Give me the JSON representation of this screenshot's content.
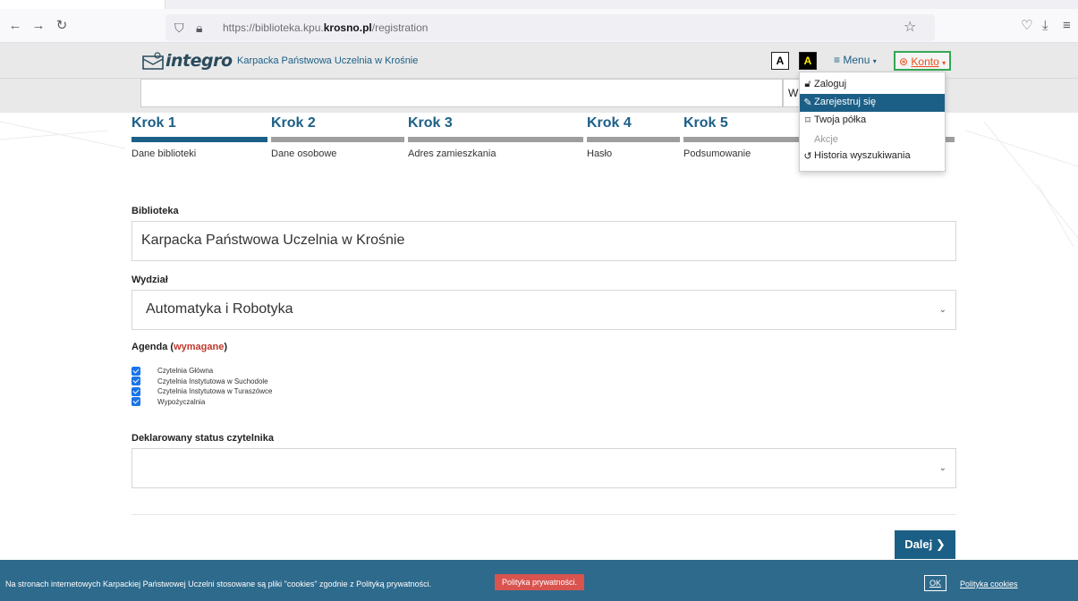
{
  "browser": {
    "url_prefix": "https://biblioteka.kpu.",
    "url_domain": "krosno.pl",
    "url_path": "/registration"
  },
  "header": {
    "logo_text": "integro",
    "institution": "Karpacka Państwowa Uczelnia w Krośnie",
    "contrast_normal": "A",
    "contrast_high": "A",
    "menu_label": "Menu",
    "account_label": "Konto"
  },
  "search": {
    "scope_value": "W"
  },
  "steps": [
    {
      "title": "Krok 1",
      "label": "Dane biblioteki",
      "active": true
    },
    {
      "title": "Krok 2",
      "label": "Dane osobowe",
      "active": false
    },
    {
      "title": "Krok 3",
      "label": "Adres zamieszkania",
      "active": false
    },
    {
      "title": "Krok 4",
      "label": "Hasło",
      "active": false
    },
    {
      "title": "Krok 5",
      "label": "Podsumowanie",
      "active": false
    }
  ],
  "form": {
    "library_label": "Biblioteka",
    "library_value": "Karpacka Państwowa Uczelnia w Krośnie",
    "faculty_label": "Wydział",
    "faculty_value": "Automatyka i Robotyka",
    "agenda_label": "Agenda",
    "agenda_required": "wymagane",
    "agenda_items": [
      {
        "label": "Czytelnia Główna",
        "checked": true
      },
      {
        "label": "Czytelnia Instytutowa w Suchodole",
        "checked": true
      },
      {
        "label": "Czytelnia Instytutowa w Turaszówce",
        "checked": true
      },
      {
        "label": "Wypożyczalnia",
        "checked": true
      }
    ],
    "status_label": "Deklarowany status czytelnika",
    "status_value": "",
    "next_label": "Dalej"
  },
  "account_menu": {
    "items": [
      {
        "label": "Zaloguj",
        "icon": "lock-icon"
      },
      {
        "label": "Zarejestruj się",
        "icon": "edit-icon",
        "active": true
      },
      {
        "label": "Twoja półka",
        "icon": "bookmark-icon"
      }
    ],
    "section_header": "Akcje",
    "actions": [
      {
        "label": "Historia wyszukiwania",
        "icon": "history-icon"
      }
    ]
  },
  "cookie": {
    "text": "Na stronach internetowych Karpackiej Państwowej Uczelni stosowane są pliki \"cookies\" zgodnie z Polityką prywatności.",
    "policy_button": "Polityka prywatności.",
    "ok_label": "OK",
    "cookie_policy_link": "Polityka cookies"
  },
  "colors": {
    "accent": "#1c5f86",
    "account_border": "#34a853",
    "account_text": "#e94e1b",
    "cookie_bg": "#2e6a8c",
    "required": "#c0392b"
  }
}
